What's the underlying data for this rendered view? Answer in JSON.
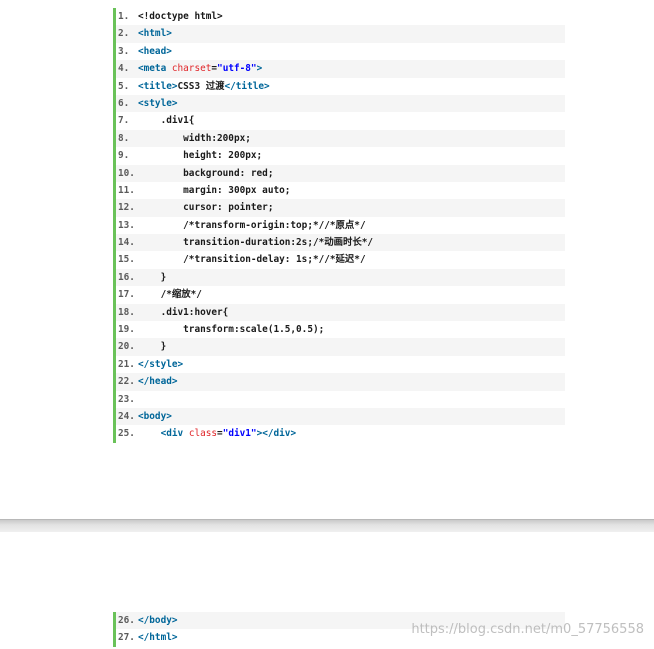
{
  "lines_page1": [
    {
      "n": "1.",
      "parts": [
        {
          "t": "<!doctype html>",
          "c": "plain"
        }
      ]
    },
    {
      "n": "2.",
      "parts": [
        {
          "t": "<html>",
          "c": "tag"
        }
      ]
    },
    {
      "n": "3.",
      "parts": [
        {
          "t": "<head>",
          "c": "tag"
        }
      ]
    },
    {
      "n": "4.",
      "parts": [
        {
          "t": "<meta ",
          "c": "tag"
        },
        {
          "t": "charset",
          "c": "attr"
        },
        {
          "t": "=",
          "c": "plain"
        },
        {
          "t": "\"utf-8\"",
          "c": "str"
        },
        {
          "t": ">",
          "c": "tag"
        }
      ]
    },
    {
      "n": "5.",
      "parts": [
        {
          "t": "<title>",
          "c": "tag"
        },
        {
          "t": "CSS3 过渡",
          "c": "plain"
        },
        {
          "t": "</title>",
          "c": "tag"
        }
      ]
    },
    {
      "n": "6.",
      "parts": [
        {
          "t": "<style>",
          "c": "tag"
        }
      ]
    },
    {
      "n": "7.",
      "parts": [
        {
          "t": "    .div1{",
          "c": "plain"
        }
      ]
    },
    {
      "n": "8.",
      "parts": [
        {
          "t": "        width:200px;",
          "c": "plain"
        }
      ]
    },
    {
      "n": "9.",
      "parts": [
        {
          "t": "        height: 200px;",
          "c": "plain"
        }
      ]
    },
    {
      "n": "10.",
      "parts": [
        {
          "t": "        background: red;",
          "c": "plain"
        }
      ]
    },
    {
      "n": "11.",
      "parts": [
        {
          "t": "        margin: 300px auto;",
          "c": "plain"
        }
      ]
    },
    {
      "n": "12.",
      "parts": [
        {
          "t": "        cursor: pointer;",
          "c": "plain"
        }
      ]
    },
    {
      "n": "13.",
      "parts": [
        {
          "t": "        /*transform-origin:top;*//*原点*/",
          "c": "cmt"
        }
      ]
    },
    {
      "n": "14.",
      "parts": [
        {
          "t": "        transition-duration:2s;/*动画时长*/",
          "c": "cmt"
        }
      ]
    },
    {
      "n": "15.",
      "parts": [
        {
          "t": "        /*transition-delay: 1s;*//*延迟*/",
          "c": "cmt"
        }
      ]
    },
    {
      "n": "16.",
      "parts": [
        {
          "t": "    }",
          "c": "plain"
        }
      ]
    },
    {
      "n": "17.",
      "parts": [
        {
          "t": "    /*缩放*/",
          "c": "cmt"
        }
      ]
    },
    {
      "n": "18.",
      "parts": [
        {
          "t": "    .div1:hover{",
          "c": "plain"
        }
      ]
    },
    {
      "n": "19.",
      "parts": [
        {
          "t": "        transform:scale(1.5,0.5);",
          "c": "plain"
        }
      ]
    },
    {
      "n": "20.",
      "parts": [
        {
          "t": "    }",
          "c": "plain"
        }
      ]
    },
    {
      "n": "21.",
      "parts": [
        {
          "t": "</style>",
          "c": "tag"
        }
      ]
    },
    {
      "n": "22.",
      "parts": [
        {
          "t": "</head>",
          "c": "tag"
        }
      ]
    },
    {
      "n": "23.",
      "parts": []
    },
    {
      "n": "24.",
      "parts": [
        {
          "t": "<body>",
          "c": "tag"
        }
      ]
    },
    {
      "n": "25.",
      "parts": [
        {
          "t": "    ",
          "c": "plain"
        },
        {
          "t": "<div ",
          "c": "tag"
        },
        {
          "t": "class",
          "c": "attr"
        },
        {
          "t": "=",
          "c": "plain"
        },
        {
          "t": "\"div1\"",
          "c": "str"
        },
        {
          "t": "></div>",
          "c": "tag"
        }
      ]
    }
  ],
  "lines_page2": [
    {
      "n": "26.",
      "parts": [
        {
          "t": "</body>",
          "c": "tag"
        }
      ]
    },
    {
      "n": "27.",
      "parts": [
        {
          "t": "</html>",
          "c": "tag"
        }
      ]
    }
  ],
  "watermark": "https://blog.csdn.net/m0_57756558",
  "colors": {
    "gutter_bar": "#6ac259",
    "tag": "#006699",
    "attr": "#e0262a",
    "string": "#0000ff",
    "stripe": "#f5f5f5"
  }
}
